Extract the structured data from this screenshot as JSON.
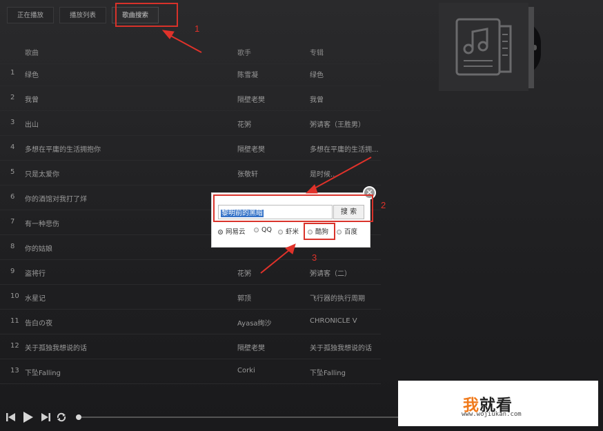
{
  "tabs": [
    {
      "label": "正在播放"
    },
    {
      "label": "播放列表"
    },
    {
      "label": "歌曲搜索"
    }
  ],
  "list": {
    "headers": {
      "num": "",
      "title": "歌曲",
      "artist": "歌手",
      "album": "专辑"
    },
    "rows": [
      {
        "num": "1",
        "title": "绿色",
        "artist": "陈雪凝",
        "album": "绿色"
      },
      {
        "num": "2",
        "title": "我曾",
        "artist": "隔壁老樊",
        "album": "我曾"
      },
      {
        "num": "3",
        "title": "出山",
        "artist": "花粥",
        "album": "粥请客（王胜男）"
      },
      {
        "num": "4",
        "title": "多想在平庸的生活拥抱你",
        "artist": "隔壁老樊",
        "album": "多想在平庸的生活拥..."
      },
      {
        "num": "5",
        "title": "只是太爱你",
        "artist": "张敬轩",
        "album": "是时候..."
      },
      {
        "num": "6",
        "title": "你的酒馆对我打了烊",
        "artist": "",
        "album": ""
      },
      {
        "num": "7",
        "title": "有一种悲伤",
        "artist": "",
        "album": ""
      },
      {
        "num": "8",
        "title": "你的姑娘",
        "artist": "",
        "album": ""
      },
      {
        "num": "9",
        "title": "盗将行",
        "artist": "花粥",
        "album": "粥请客（二）"
      },
      {
        "num": "10",
        "title": "水星记",
        "artist": "郭顶",
        "album": "飞行器的执行周期"
      },
      {
        "num": "11",
        "title": "告白の夜",
        "artist": "Ayasa绚沙",
        "album": "CHRONICLE V"
      },
      {
        "num": "12",
        "title": "关于孤独我想说的话",
        "artist": "隔壁老樊",
        "album": "关于孤独我想说的话"
      },
      {
        "num": "13",
        "title": "下坠Falling",
        "artist": "Corki",
        "album": "下坠Falling"
      }
    ]
  },
  "dialog": {
    "search_value": "黎明前的黑暗",
    "search_button": "搜 索",
    "close_glyph": "✕",
    "sources": [
      {
        "label": "网易云",
        "selected": true
      },
      {
        "label": "QQ",
        "selected": false
      },
      {
        "label": "虾米",
        "selected": false
      },
      {
        "label": "酷狗",
        "selected": false
      },
      {
        "label": "百度",
        "selected": false
      }
    ]
  },
  "annotations": {
    "one": "1",
    "two": "2",
    "three": "3"
  },
  "annotation_color": "#d9322a",
  "watermark": {
    "char": "我",
    "rest": "就看",
    "url": "www.wojiukan.com"
  },
  "icons": [
    "music-file-icon",
    "prev-icon",
    "play-icon",
    "next-icon",
    "repeat-icon",
    "close-icon"
  ]
}
